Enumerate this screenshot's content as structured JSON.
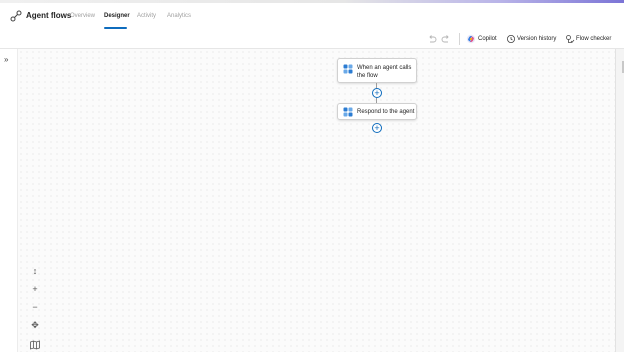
{
  "app": {
    "title": "Agent flows"
  },
  "tabs": [
    {
      "label": "Overview",
      "active": false
    },
    {
      "label": "Designer",
      "active": true
    },
    {
      "label": "Activity",
      "active": false
    },
    {
      "label": "Analytics",
      "active": false
    }
  ],
  "toolbar": {
    "undo_icon": "undo-icon",
    "redo_icon": "redo-icon",
    "copilot_label": "Copilot",
    "version_history_label": "Version history",
    "flow_checker_label": "Flow checker"
  },
  "flow": {
    "nodes": [
      {
        "line1": "When an agent calls",
        "line2": "the flow",
        "icon": "agent-trigger-icon"
      },
      {
        "line1": "Respond to the agent",
        "icon": "agent-response-icon"
      }
    ]
  },
  "colors": {
    "accent": "#0f6cbd",
    "canvas_dot": "#dedede",
    "gradient_end": "#7b74d6"
  }
}
